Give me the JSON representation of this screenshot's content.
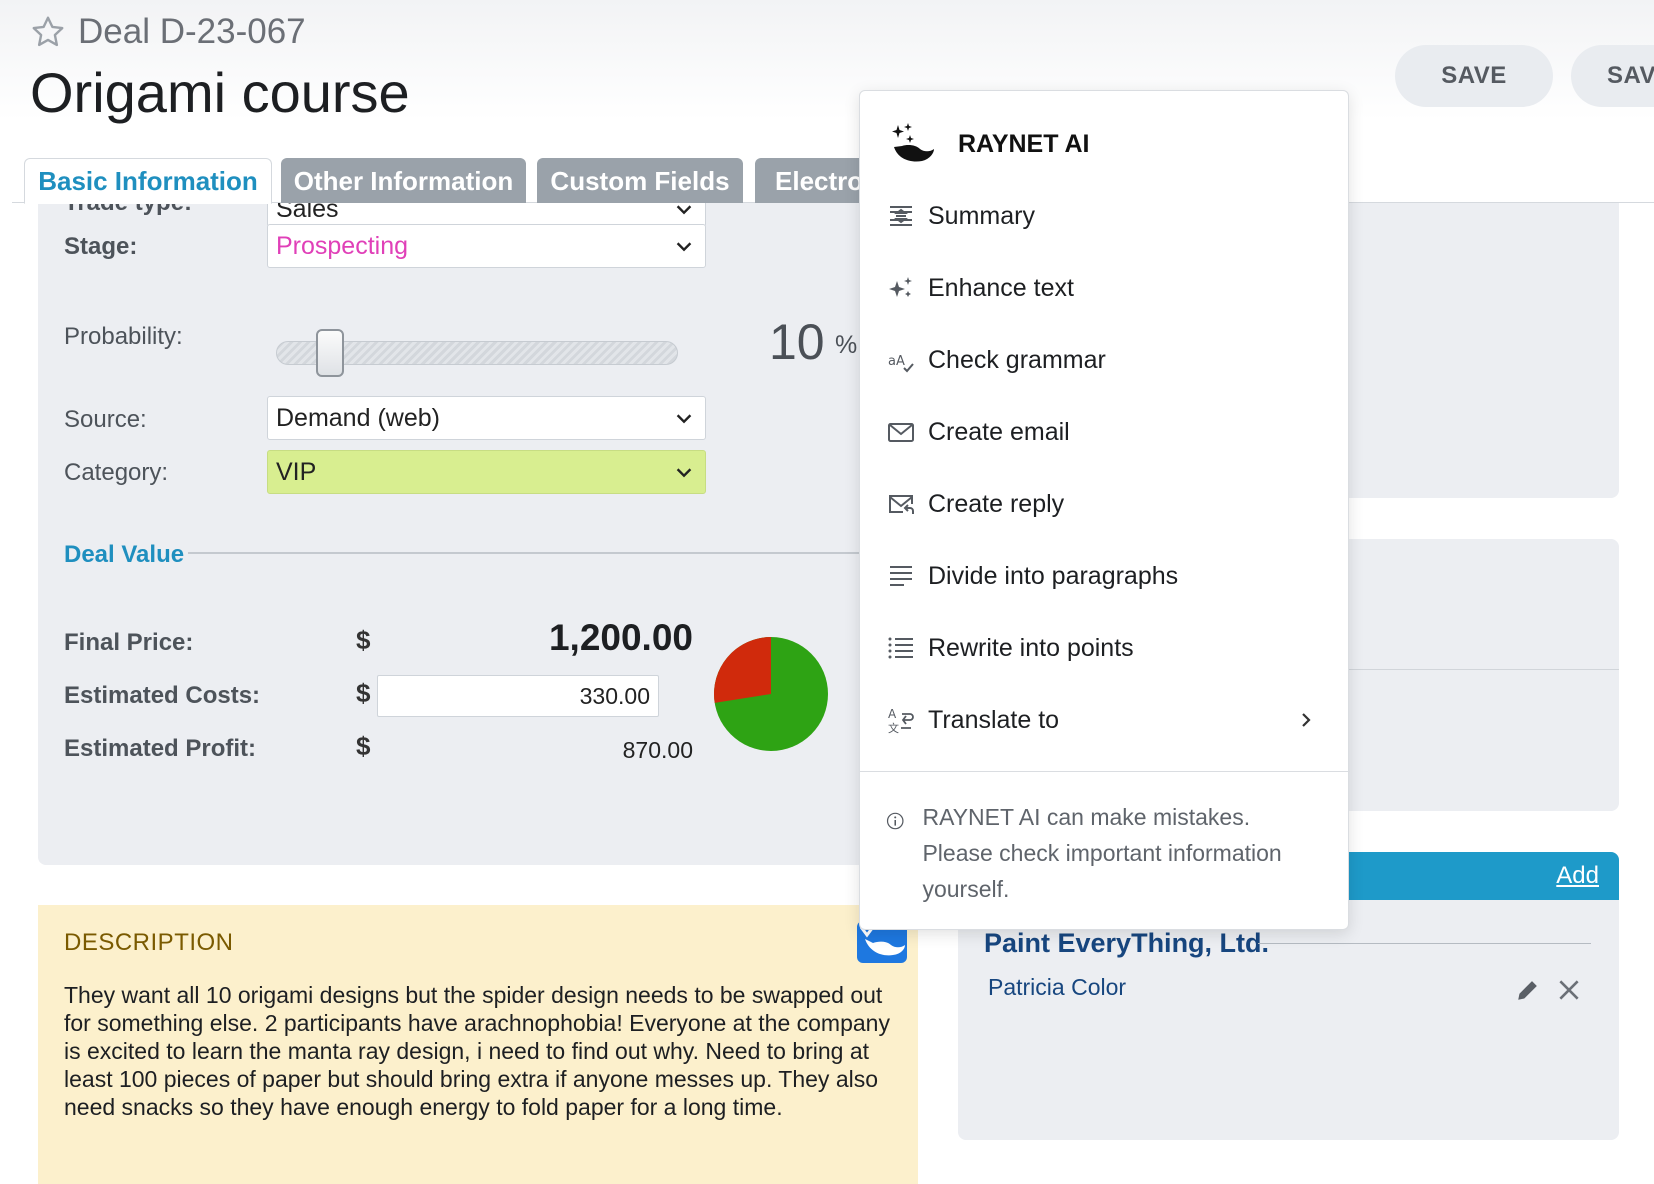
{
  "header": {
    "deal_code": "Deal D-23-067",
    "title": "Origami course",
    "buttons": [
      "SAVE",
      "SAV"
    ]
  },
  "tabs": [
    {
      "label": "Basic Information",
      "active": true
    },
    {
      "label": "Other Information",
      "active": false
    },
    {
      "label": "Custom Fields",
      "active": false
    },
    {
      "label": "Electro",
      "active": false
    }
  ],
  "form": {
    "trade_type": {
      "label": "Trade type:",
      "value": "Sales"
    },
    "stage": {
      "label": "Stage:",
      "value": "Prospecting"
    },
    "probability": {
      "label": "Probability:",
      "value": "10",
      "unit": "%",
      "percent": 10
    },
    "source": {
      "label": "Source:",
      "value": "Demand (web)"
    },
    "category": {
      "label": "Category:",
      "value": "VIP"
    }
  },
  "deal_value": {
    "title": "Deal Value",
    "currency": "$",
    "final_price": {
      "label": "Final Price:",
      "value": "1,200.00"
    },
    "estimated_costs": {
      "label": "Estimated Costs:",
      "value": "330.00"
    },
    "estimated_profit": {
      "label": "Estimated Profit:",
      "value": "870.00"
    },
    "pie": {
      "costs": 330,
      "profit": 870,
      "costs_color": "#d02a0c",
      "profit_color": "#2ea314"
    }
  },
  "description": {
    "title": "DESCRIPTION",
    "text": "They want all 10 origami designs but the spider design needs to be swapped out for something else. 2 participants have arachnophobia! Everyone at the company is excited to learn the manta ray design, i need to find out why. Need to bring at least 100 pieces of paper but should bring extra if anyone messes up. They also need snacks so they have enough energy to fold paper for a long time."
  },
  "contacts": {
    "add_label": "Add",
    "company": "Paint EveryThing, Ltd.",
    "person": "Patricia Color"
  },
  "ai_menu": {
    "title": "RAYNET AI",
    "items": [
      {
        "label": "Summary",
        "icon": "summary-icon"
      },
      {
        "label": "Enhance text",
        "icon": "sparkle-icon"
      },
      {
        "label": "Check grammar",
        "icon": "grammar-icon"
      },
      {
        "label": "Create email",
        "icon": "mail-icon"
      },
      {
        "label": "Create reply",
        "icon": "mail-reply-icon"
      },
      {
        "label": "Divide into paragraphs",
        "icon": "paragraphs-icon"
      },
      {
        "label": "Rewrite into points",
        "icon": "list-icon"
      },
      {
        "label": "Translate to",
        "icon": "translate-icon"
      }
    ],
    "disclaimer": "RAYNET AI can make mistakes. Please check important information yourself."
  },
  "colors": {
    "accent": "#1f8fbf",
    "stage_pink": "#e040b8",
    "category_green": "#d8ee90",
    "description_bg": "#fcf0cc",
    "contacts_header": "#1e9ac9"
  }
}
